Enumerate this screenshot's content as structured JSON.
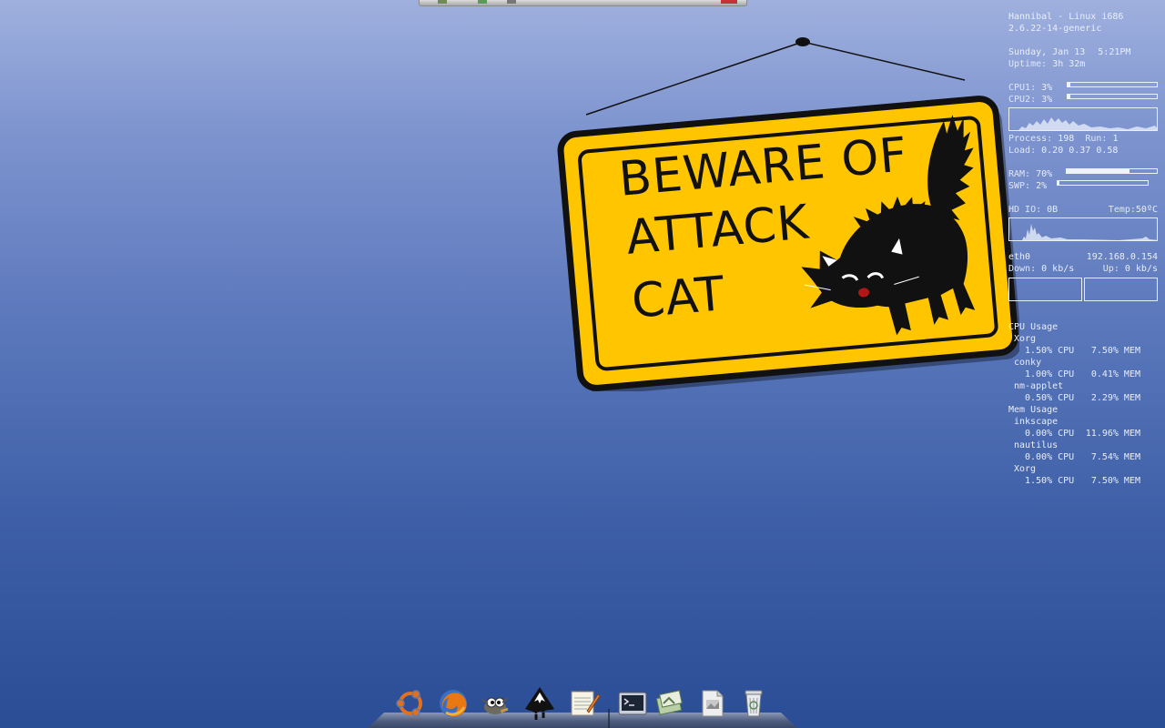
{
  "sign": {
    "line1": "BEWARE OF",
    "line2": "ATTACK",
    "line3": "CAT"
  },
  "conky": {
    "host_line": "Hannibal - Linux i686",
    "kernel": "2.6.22-14-generic",
    "date": "Sunday, Jan 13",
    "time": "5:21PM",
    "uptime_label": "Uptime:",
    "uptime": "3h 32m",
    "cpu1_label": "CPU1:",
    "cpu1": "3%",
    "cpu1_level": 0.03,
    "cpu2_label": "CPU2:",
    "cpu2": "3%",
    "cpu2_level": 0.03,
    "process_label": "Process:",
    "process": "198",
    "run_label": "Run:",
    "run": "1",
    "load_label": "Load:",
    "load": "0.20 0.37 0.58",
    "ram_label": "RAM:",
    "ram": "70%",
    "ram_level": 0.7,
    "swp_label": "SWP:",
    "swp": "2%",
    "swp_level": 0.02,
    "hdio_label": "HD IO:",
    "hdio": "0B",
    "temp_label": "Temp:",
    "temp": "50ºC",
    "iface": "eth0",
    "ip": "192.168.0.154",
    "down_label": "Down:",
    "down": "0 kb/s",
    "up_label": "Up:",
    "up": "0 kb/s",
    "cpu_usage_title": "CPU Usage",
    "cpu_procs": [
      {
        "name": "Xorg",
        "cpu": "1.50% CPU",
        "mem": "7.50% MEM"
      },
      {
        "name": "conky",
        "cpu": "1.00% CPU",
        "mem": "0.41% MEM"
      },
      {
        "name": "nm-applet",
        "cpu": "0.50% CPU",
        "mem": "2.29% MEM"
      }
    ],
    "mem_usage_title": "Mem Usage",
    "mem_procs": [
      {
        "name": "inkscape",
        "cpu": "0.00% CPU",
        "mem": "11.96% MEM"
      },
      {
        "name": "nautilus",
        "cpu": "0.00% CPU",
        "mem": "7.54% MEM"
      },
      {
        "name": "Xorg",
        "cpu": "1.50% CPU",
        "mem": "7.50% MEM"
      }
    ]
  },
  "dock": {
    "items": [
      {
        "icon": "ubuntu-icon"
      },
      {
        "icon": "firefox-icon"
      },
      {
        "icon": "gimp-icon"
      },
      {
        "icon": "inkscape-icon"
      },
      {
        "icon": "text-editor-icon"
      },
      {
        "icon": "terminal-icon"
      },
      {
        "icon": "file-manager-icon"
      },
      {
        "icon": "document-icon"
      },
      {
        "icon": "trash-icon"
      }
    ]
  },
  "colors": {
    "sign_yellow": "#ffc600",
    "sign_border": "#111111",
    "desktop_top": "#9fb0de",
    "desktop_bottom": "#2a4d95",
    "conky_text": "#e9eef8"
  }
}
